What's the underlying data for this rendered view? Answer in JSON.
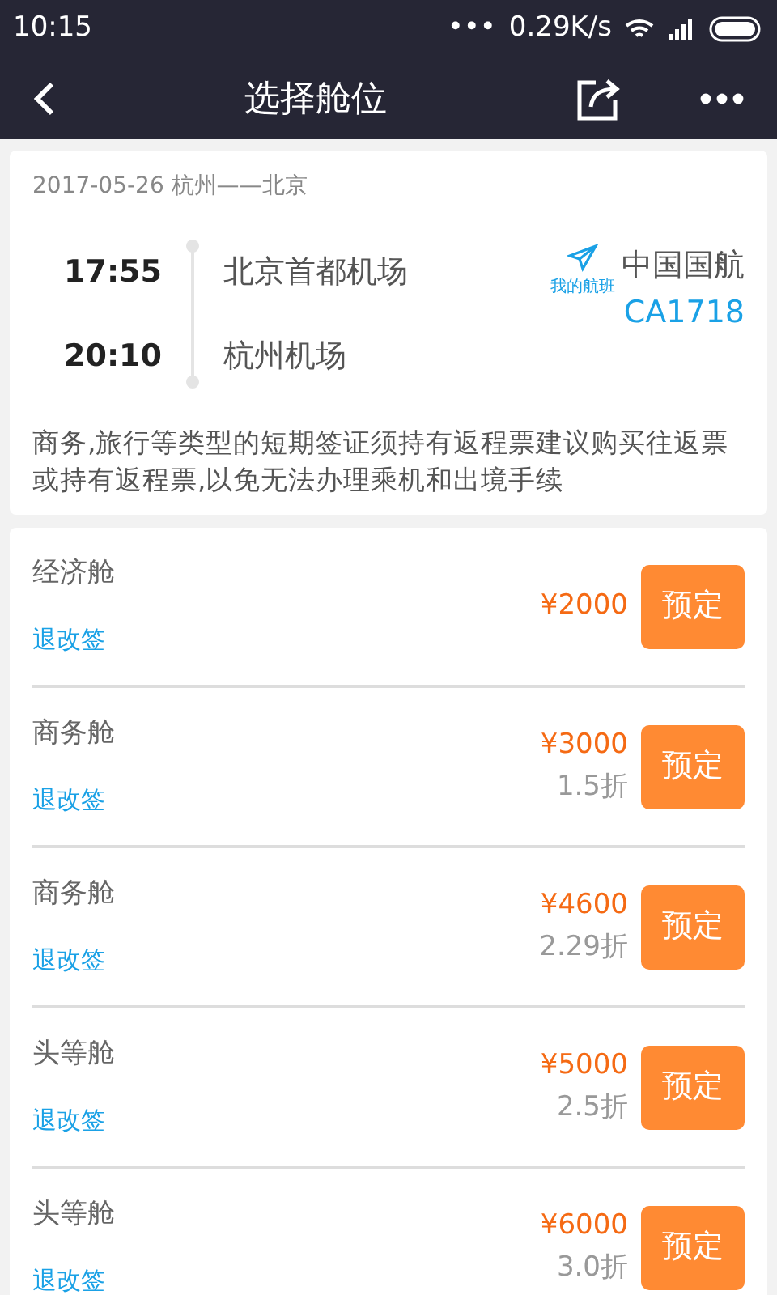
{
  "status_bar": {
    "time": "10:15",
    "more": "•••",
    "speed": "0.29K/s"
  },
  "nav": {
    "title": "选择舱位"
  },
  "flight": {
    "header": "2017-05-26 杭州——北京",
    "depart_time": "17:55",
    "depart_airport": "北京首都机场",
    "arrive_time": "20:10",
    "arrive_airport": "杭州机场",
    "my_flight_label": "我的航班",
    "airline": "中国国航",
    "flight_no": "CA1718",
    "notice": "商务,旅行等类型的短期签证须持有返程票建议购买往返票或持有返程票,以免无法办理乘机和出境手续"
  },
  "cabins": [
    {
      "name": "经济舱",
      "rules": "退改签",
      "price": "¥2000",
      "button": "预定"
    },
    {
      "name": "商务舱",
      "rules": "退改签",
      "price": "¥3000",
      "discount": "1.5折",
      "button": "预定"
    },
    {
      "name": "商务舱",
      "rules": "退改签",
      "price": "¥4600",
      "discount": "2.29折",
      "button": "预定"
    },
    {
      "name": "头等舱",
      "rules": "退改签",
      "price": "¥5000",
      "discount": "2.5折",
      "button": "预定"
    },
    {
      "name": "头等舱",
      "rules": "退改签",
      "price": "¥6000",
      "discount": "3.0折",
      "button": "预定"
    }
  ]
}
